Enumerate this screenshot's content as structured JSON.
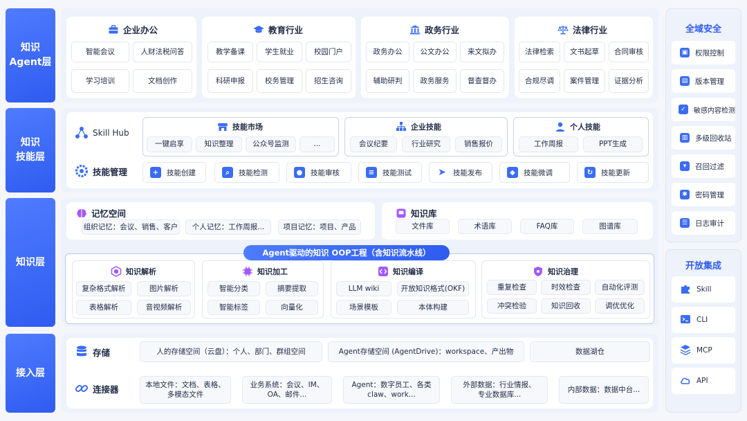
{
  "layers": {
    "agent": "知识\nAgent层",
    "skill": "知识\n技能层",
    "knowledge": "知识层",
    "access": "接入层"
  },
  "agent_layer": {
    "sectors": [
      {
        "title": "企业办公",
        "icon": "briefcase-icon",
        "items": [
          "智能会议",
          "人财法税问答",
          "学习培训",
          "文档创作"
        ]
      },
      {
        "title": "教育行业",
        "icon": "graduation-cap-icon",
        "items": [
          "教学备课",
          "学生就业",
          "校园门户",
          "科研申报",
          "校务管理",
          "招生咨询"
        ]
      },
      {
        "title": "政务行业",
        "icon": "government-building-icon",
        "items": [
          "政务办公",
          "公文办公",
          "来文拟办",
          "辅助研判",
          "政务服务",
          "督查督办"
        ]
      },
      {
        "title": "法律行业",
        "icon": "scales-icon",
        "items": [
          "法律检索",
          "文书起草",
          "合同审核",
          "合规尽调",
          "案件管理",
          "证据分析"
        ]
      }
    ]
  },
  "skill_layer": {
    "hub": "Skill Hub",
    "manage": "技能管理",
    "market": {
      "title": "技能市场",
      "items": [
        "一键启享",
        "知识整理",
        "公众号监测",
        "..."
      ]
    },
    "enterprise": {
      "title": "企业技能",
      "items": [
        "会议纪要",
        "行业研究",
        "销售报价"
      ]
    },
    "personal": {
      "title": "个人技能",
      "items": [
        "工作周报",
        "PPT生成"
      ]
    },
    "tools": [
      "技能创建",
      "技能检测",
      "技能审核",
      "技能测试",
      "技能发布",
      "技能微调",
      "技能更新"
    ]
  },
  "knowledge_layer": {
    "memory": {
      "title": "记忆空间",
      "items": [
        "组织记忆：会议、销售、客户",
        "个人记忆：工作周报...",
        "项目记忆：项目、产品"
      ]
    },
    "library": {
      "title": "知识库",
      "items": [
        "文件库",
        "术语库",
        "FAQ库",
        "图谱库"
      ]
    },
    "pipeline": "Agent驱动的知识 OOP工程（含知识流水线）",
    "stages": [
      {
        "title": "知识解析",
        "items": [
          "复杂格式解析",
          "图片解析",
          "表格解析",
          "音视频解析"
        ]
      },
      {
        "title": "知识加工",
        "items": [
          "智能分类",
          "摘要提取",
          "智能标签",
          "向量化"
        ]
      },
      {
        "title": "知识编译",
        "items": [
          "LLM wiki",
          "开放知识格式(OKF)",
          "场景模板",
          "本体构建"
        ]
      },
      {
        "title": "知识治理",
        "items": [
          "重复检查",
          "时效检查",
          "自动化评测",
          "冲突检验",
          "知识回收",
          "调优优化"
        ]
      }
    ]
  },
  "access_layer": {
    "storage": {
      "title": "存储",
      "items": [
        "人的存储空间（云盘）：个人、部门、群组空间",
        "Agent存储空间 (AgentDrive)：workspace、产出物",
        "数据湖仓"
      ]
    },
    "connector": {
      "title": "连接器",
      "items": [
        "本地文件：文档、表格、\n多模态文件",
        "业务系统：会议、IM、\nOA、邮件...",
        "Agent：数字员工、各类\nclaw、work...",
        "外部数据：行业情报、\n专业数据库...",
        "内部数据：数据中台..."
      ]
    }
  },
  "security": {
    "title": "全域安全",
    "items": [
      "权限控制",
      "版本管理",
      "敏感内容检测",
      "多级回收站",
      "召回过滤",
      "密码管理",
      "日志审计"
    ]
  },
  "integration": {
    "title": "开放集成",
    "items": [
      "Skill",
      "CLI",
      "MCP",
      "API"
    ]
  },
  "colors": {
    "accent": "#2f5cf0",
    "panel": "#eef2fa"
  }
}
